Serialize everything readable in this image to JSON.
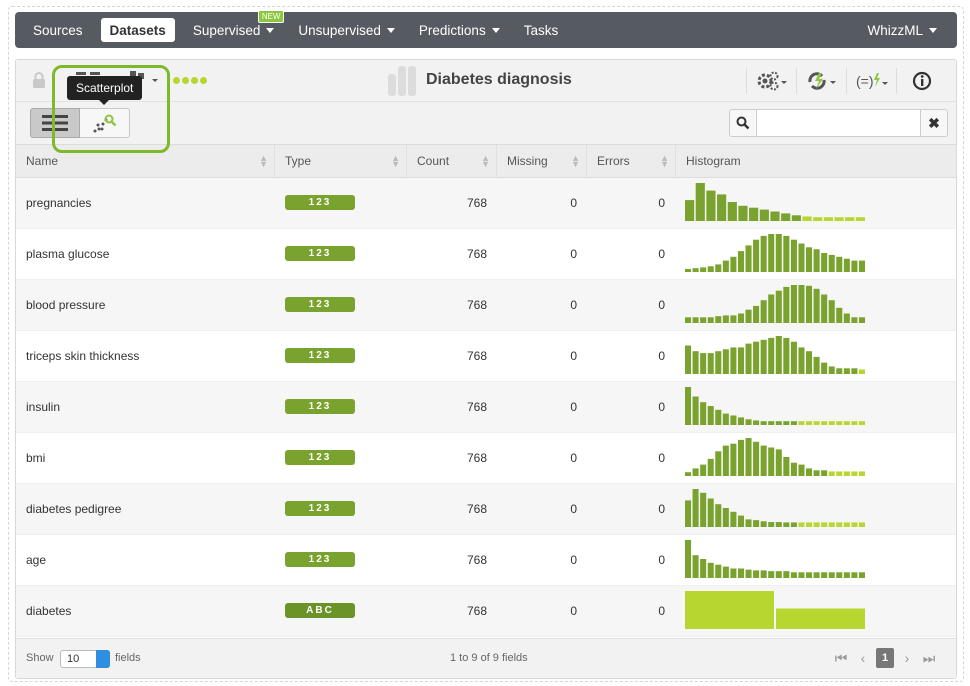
{
  "nav": {
    "items": [
      {
        "label": "Sources",
        "active": false,
        "caret": false
      },
      {
        "label": "Datasets",
        "active": true,
        "caret": false
      },
      {
        "label": "Supervised",
        "active": false,
        "caret": true,
        "badge": "NEW"
      },
      {
        "label": "Unsupervised",
        "active": false,
        "caret": true
      },
      {
        "label": "Predictions",
        "active": false,
        "caret": true
      },
      {
        "label": "Tasks",
        "active": false,
        "caret": false
      }
    ],
    "user": "WhizzML"
  },
  "dataset": {
    "title": "Diabetes diagnosis"
  },
  "tooltip": "Scatterplot",
  "search": {
    "placeholder": "",
    "value": ""
  },
  "table": {
    "headers": [
      "Name",
      "Type",
      "Count",
      "Missing",
      "Errors",
      "Histogram"
    ],
    "rows": [
      {
        "name": "pregnancies",
        "type": "123",
        "count": "768",
        "missing": "0",
        "errors": "0",
        "hist": [
          0.55,
          1.0,
          0.8,
          0.7,
          0.5,
          0.4,
          0.35,
          0.3,
          0.25,
          0.2,
          0.15,
          0.12,
          0.1,
          0.1,
          0.1,
          0.1,
          0.1
        ]
      },
      {
        "name": "plasma glucose",
        "type": "123",
        "count": "768",
        "missing": "0",
        "errors": "0",
        "hist": [
          0.08,
          0.1,
          0.12,
          0.15,
          0.2,
          0.3,
          0.4,
          0.55,
          0.7,
          0.85,
          0.95,
          1.0,
          1.0,
          0.95,
          0.85,
          0.75,
          0.65,
          0.6,
          0.5,
          0.45,
          0.4,
          0.35,
          0.3,
          0.3
        ]
      },
      {
        "name": "blood pressure",
        "type": "123",
        "count": "768",
        "missing": "0",
        "errors": "0",
        "hist": [
          0.15,
          0.15,
          0.15,
          0.15,
          0.18,
          0.2,
          0.2,
          0.25,
          0.35,
          0.45,
          0.6,
          0.75,
          0.85,
          0.95,
          1.0,
          1.0,
          0.98,
          0.9,
          0.75,
          0.6,
          0.4,
          0.25,
          0.15,
          0.15
        ]
      },
      {
        "name": "triceps skin thickness",
        "type": "123",
        "count": "768",
        "missing": "0",
        "errors": "0",
        "hist": [
          0.75,
          0.6,
          0.55,
          0.55,
          0.6,
          0.65,
          0.7,
          0.7,
          0.8,
          0.85,
          0.9,
          0.95,
          1.0,
          0.95,
          0.85,
          0.7,
          0.6,
          0.45,
          0.3,
          0.2,
          0.15,
          0.15,
          0.15,
          0.12
        ]
      },
      {
        "name": "insulin",
        "type": "123",
        "count": "768",
        "missing": "0",
        "errors": "0",
        "hist": [
          1.0,
          0.75,
          0.6,
          0.5,
          0.4,
          0.3,
          0.25,
          0.2,
          0.15,
          0.12,
          0.1,
          0.1,
          0.1,
          0.1,
          0.1,
          0.1,
          0.1,
          0.1,
          0.1,
          0.1,
          0.1,
          0.1,
          0.1,
          0.1
        ]
      },
      {
        "name": "bmi",
        "type": "123",
        "count": "768",
        "missing": "0",
        "errors": "0",
        "hist": [
          0.1,
          0.2,
          0.3,
          0.45,
          0.65,
          0.8,
          0.85,
          0.95,
          1.0,
          0.9,
          0.8,
          0.75,
          0.7,
          0.5,
          0.35,
          0.3,
          0.2,
          0.15,
          0.15,
          0.12,
          0.12,
          0.12,
          0.12,
          0.12
        ]
      },
      {
        "name": "diabetes pedigree",
        "type": "123",
        "count": "768",
        "missing": "0",
        "errors": "0",
        "hist": [
          0.7,
          1.0,
          0.9,
          0.75,
          0.6,
          0.5,
          0.4,
          0.3,
          0.2,
          0.18,
          0.15,
          0.13,
          0.13,
          0.12,
          0.12,
          0.12,
          0.12,
          0.12,
          0.12,
          0.12,
          0.12,
          0.12,
          0.12,
          0.12
        ]
      },
      {
        "name": "age",
        "type": "123",
        "count": "768",
        "missing": "0",
        "errors": "0",
        "hist": [
          1.0,
          0.6,
          0.5,
          0.4,
          0.35,
          0.3,
          0.25,
          0.25,
          0.22,
          0.2,
          0.2,
          0.18,
          0.18,
          0.18,
          0.15,
          0.15,
          0.15,
          0.15,
          0.15,
          0.15,
          0.15,
          0.15,
          0.15,
          0.15
        ]
      },
      {
        "name": "diabetes",
        "type": "ABC",
        "count": "768",
        "missing": "0",
        "errors": "0",
        "hist": [
          1.0,
          0.54
        ]
      }
    ]
  },
  "footer": {
    "show_label": "Show",
    "page_size": "10",
    "fields_label": "fields",
    "summary": "1 to 9 of 9 fields",
    "current_page": "1"
  },
  "colors": {
    "navbar": "#555b60",
    "histogram_bar": "#7aa22e",
    "histogram_bar_light": "#b7d630",
    "highlight": "#7fb82a"
  }
}
